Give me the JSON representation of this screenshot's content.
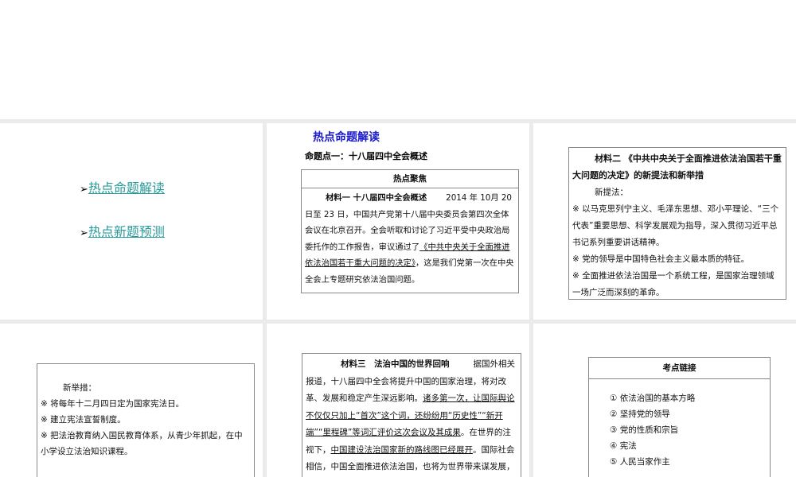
{
  "slides": {
    "s1": {
      "links": [
        "热点命题解读",
        "热点新题预测"
      ]
    },
    "s2": {
      "title": "热点命题解读",
      "subtitle": "命题点一：十八届四中全会概述",
      "box_header": "热点聚焦",
      "mat_title": "材料一  十八届四中全会概述",
      "mat_date": "2014 年 10",
      "text1": "月 20 日至 23 日，中国共产党第十八届中央委员会第四次全体会议在北京召开。全会听取和讨论了习近平受中央政治局委托作的工作报告，审议通过了",
      "text_u": "《中共中央关于全面推进依法治国若干重大问题的决定》",
      "text2": "，这是我们党第一次在中央全会上专题研究依法治国问题。"
    },
    "s3": {
      "mat_title": "材料二 《中共中央关于全面推进依法治国若干重大问题的决定》的新提法和新举措",
      "sub": "新提法：",
      "items": [
        "※ 以马克思列宁主义、毛泽东思想、邓小平理论、“三个代表”重要思想、科学发展观为指导，深入贯彻习近平总书记系列重要讲话精神。",
        "※ 党的领导是中国特色社会主义最本质的特征。",
        "※ 全面推进依法治国是一个系统工程，是国家治理领域一场广泛而深刻的革命。"
      ]
    },
    "s4": {
      "sub": "新举措：",
      "items": [
        "※ 将每年十二月四日定为国家宪法日。",
        "※ 建立宪法宣誓制度。",
        "※ 把法治教育纳入国民教育体系，从青少年抓起，在中小学设立法治知识课程。"
      ]
    },
    "s5": {
      "mat_title": "材料三　法治中国的世界回响",
      "t1": "据国外相关报道，十八届四中全会将提升中国的国家治理，将对改革、发展和稳定产生深远影响。",
      "t2u": "诸多第一次，让国际舆论不仅仅只加上“首次”这个词，还纷纷用“历史性”“新开端”“里程碑”等词汇评价这次会议及其成果",
      "t3": "。在世界的注视下，",
      "t4u": "中国建设法治国家新的路线图已经展开",
      "t5": "。国际社会相信，中国全面推进依法治国，也将为世界带来谋发展，促繁荣"
    },
    "s6": {
      "header": "考点链接",
      "items": [
        "① 依法治国的基本方略",
        "② 坚持党的领导",
        "③ 党的性质和宗旨",
        "④ 宪法",
        "⑤ 人民当家作主"
      ]
    }
  }
}
